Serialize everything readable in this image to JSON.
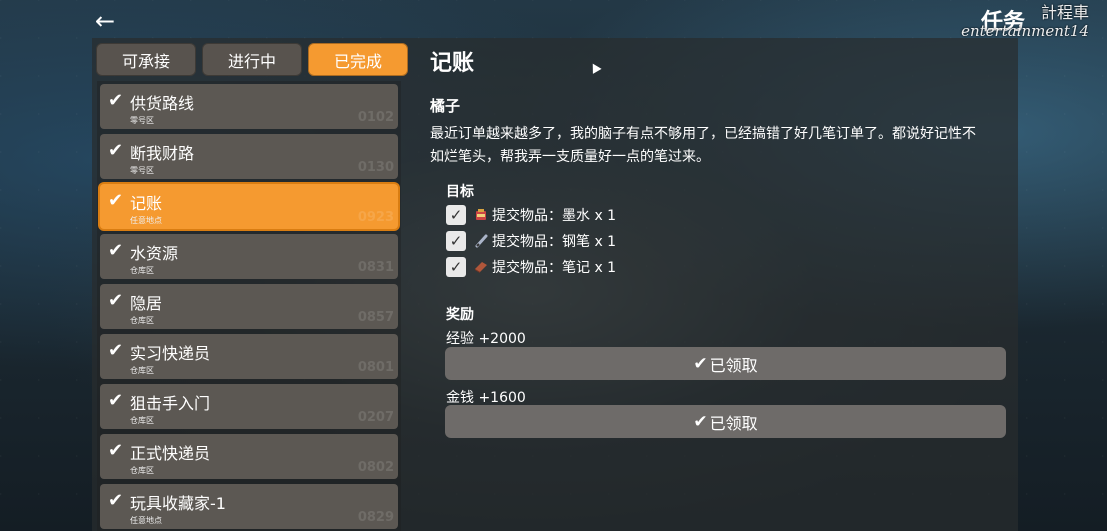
{
  "header": {
    "back_icon": "arrow-left-icon",
    "title": "任务",
    "watermark_line1": "計程車",
    "watermark_line2": "entertainment14"
  },
  "tabs": [
    {
      "label": "可承接",
      "active": false
    },
    {
      "label": "进行中",
      "active": false
    },
    {
      "label": "已完成",
      "active": true
    }
  ],
  "quests": [
    {
      "name": "供货路线",
      "location": "零号区",
      "code": "0102",
      "active": false
    },
    {
      "name": "断我财路",
      "location": "零号区",
      "code": "0130",
      "active": false
    },
    {
      "name": "记账",
      "location": "任意地点",
      "code": "0923",
      "active": true
    },
    {
      "name": "水资源",
      "location": "仓库区",
      "code": "0831",
      "active": false
    },
    {
      "name": "隐居",
      "location": "仓库区",
      "code": "0857",
      "active": false
    },
    {
      "name": "实习快递员",
      "location": "仓库区",
      "code": "0801",
      "active": false
    },
    {
      "name": "狙击手入门",
      "location": "仓库区",
      "code": "0207",
      "active": false
    },
    {
      "name": "正式快递员",
      "location": "仓库区",
      "code": "0802",
      "active": false
    },
    {
      "name": "玩具收藏家-1",
      "location": "任意地点",
      "code": "0829",
      "active": false
    }
  ],
  "detail": {
    "title": "记账",
    "giver": "橘子",
    "description_line1": "最近订单越来越多了，我的脑子有点不够用了，已经搞错了好几笔订单了。都说好记性不",
    "description_line2": "如烂笔头，帮我弄一支质量好一点的笔过来。",
    "objectives_heading": "目标",
    "objectives": [
      {
        "text": "提交物品：墨水 x 1",
        "icon": "ink-icon",
        "done": true
      },
      {
        "text": "提交物品：钢笔 x 1",
        "icon": "pen-icon",
        "done": true
      },
      {
        "text": "提交物品：笔记 x 1",
        "icon": "notebook-icon",
        "done": true
      }
    ],
    "rewards_heading": "奖励",
    "rewards": [
      {
        "label": "经验 +2000",
        "button": "已领取"
      },
      {
        "label": "金钱 +1600",
        "button": "已领取"
      }
    ]
  },
  "colors": {
    "accent": "#f59a30",
    "tab_inactive": "#58534e",
    "item_bg": "#5c5853",
    "claim_bg": "#6e6b69"
  }
}
